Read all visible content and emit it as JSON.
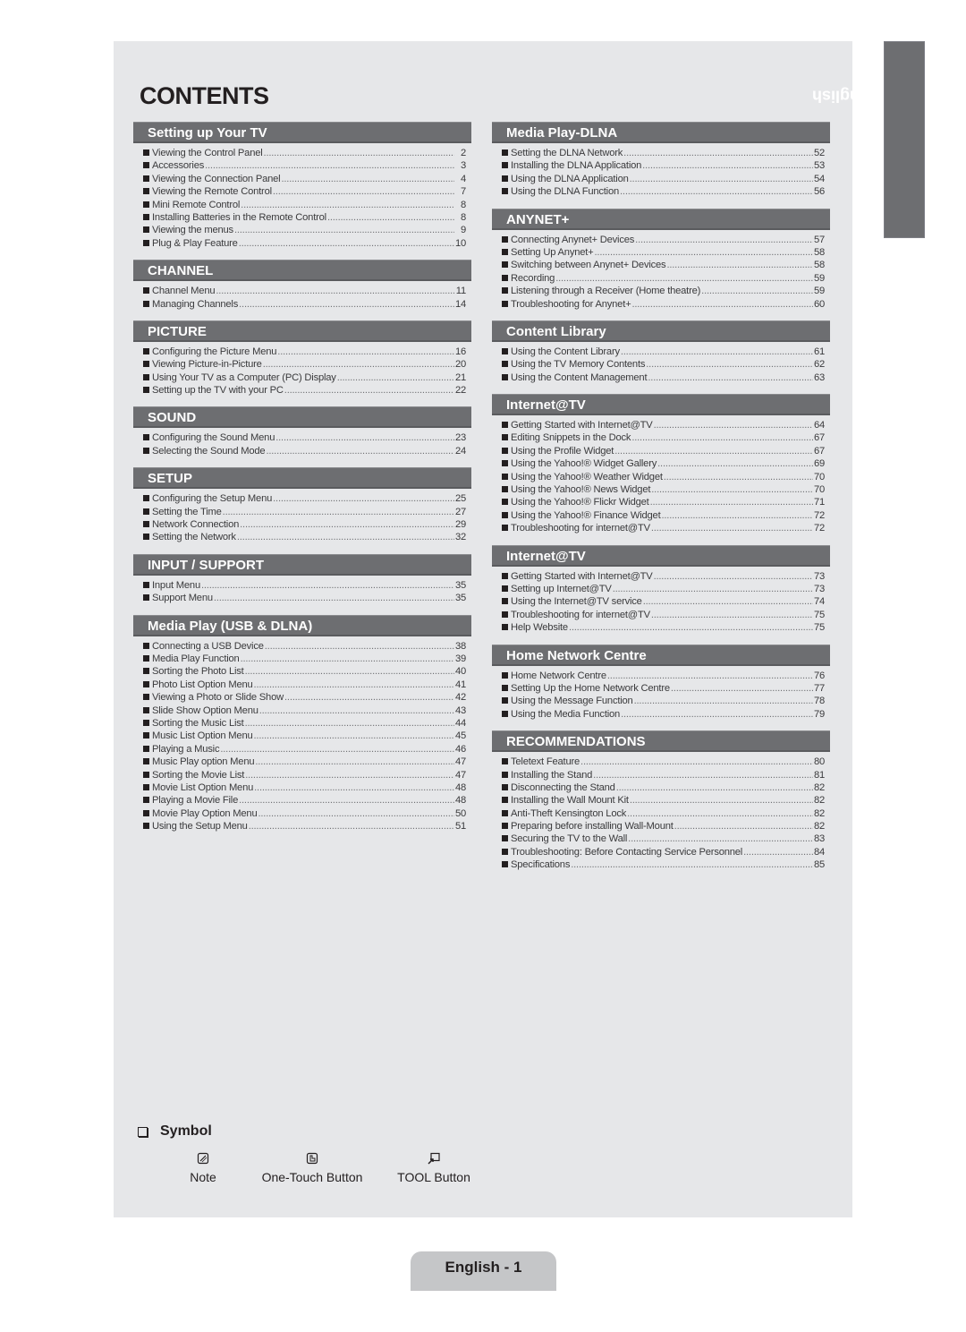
{
  "title": "CONTENTS",
  "language_tab": "English",
  "footer": "English - 1",
  "left_sections": [
    {
      "heading": "Setting up Your TV",
      "items": [
        {
          "label": "Viewing the Control Panel",
          "page": "2"
        },
        {
          "label": "Accessories",
          "page": "3"
        },
        {
          "label": "Viewing the Connection Panel",
          "page": "4"
        },
        {
          "label": "Viewing the Remote Control",
          "page": "7"
        },
        {
          "label": "Mini Remote Control",
          "page": "8"
        },
        {
          "label": "Installing Batteries in the Remote Control",
          "page": "8"
        },
        {
          "label": "Viewing the menus",
          "page": "9"
        },
        {
          "label": "Plug & Play Feature",
          "page": "10"
        }
      ]
    },
    {
      "heading": "CHANNEL",
      "items": [
        {
          "label": "Channel Menu",
          "page": "11"
        },
        {
          "label": "Managing Channels",
          "page": "14"
        }
      ]
    },
    {
      "heading": "PICTURE",
      "items": [
        {
          "label": "Configuring the Picture Menu",
          "page": "16"
        },
        {
          "label": "Viewing Picture-in-Picture",
          "page": "20"
        },
        {
          "label": "Using Your TV as a Computer (PC) Display",
          "page": "21"
        },
        {
          "label": "Setting up the TV with your PC",
          "page": "22"
        }
      ]
    },
    {
      "heading": "SOUND",
      "items": [
        {
          "label": "Configuring the Sound Menu",
          "page": "23"
        },
        {
          "label": "Selecting the Sound Mode",
          "page": "24"
        }
      ]
    },
    {
      "heading": "SETUP",
      "items": [
        {
          "label": "Configuring the Setup Menu",
          "page": "25"
        },
        {
          "label": "Setting the Time",
          "page": "27"
        },
        {
          "label": "Network Connection",
          "page": "29"
        },
        {
          "label": "Setting the Network",
          "page": "32"
        }
      ]
    },
    {
      "heading": "INPUT / SUPPORT",
      "items": [
        {
          "label": "Input Menu",
          "page": "35"
        },
        {
          "label": "Support Menu",
          "page": "35"
        }
      ]
    },
    {
      "heading": "Media Play (USB & DLNA)",
      "items": [
        {
          "label": "Connecting a USB Device",
          "page": "38"
        },
        {
          "label": "Media Play Function",
          "page": "39"
        },
        {
          "label": "Sorting the Photo List",
          "page": "40"
        },
        {
          "label": "Photo List Option Menu",
          "page": "41"
        },
        {
          "label": "Viewing a Photo or Slide Show",
          "page": "42"
        },
        {
          "label": "Slide Show Option Menu",
          "page": "43"
        },
        {
          "label": "Sorting the Music List",
          "page": "44"
        },
        {
          "label": "Music List Option Menu",
          "page": "45"
        },
        {
          "label": "Playing a Music",
          "page": "46"
        },
        {
          "label": "Music Play option Menu",
          "page": "47"
        },
        {
          "label": "Sorting the Movie List",
          "page": "47"
        },
        {
          "label": "Movie List Option Menu",
          "page": "48"
        },
        {
          "label": "Playing a Movie File",
          "page": "48"
        },
        {
          "label": "Movie Play Option Menu",
          "page": "50"
        },
        {
          "label": "Using the Setup Menu",
          "page": "51"
        }
      ]
    }
  ],
  "right_sections": [
    {
      "heading": "Media Play-DLNA",
      "items": [
        {
          "label": "Setting the DLNA Network",
          "page": "52"
        },
        {
          "label": "Installing the DLNA Application",
          "page": "53"
        },
        {
          "label": "Using the DLNA Application",
          "page": "54"
        },
        {
          "label": "Using the DLNA Function",
          "page": "56"
        }
      ]
    },
    {
      "heading": "ANYNET+",
      "items": [
        {
          "label": "Connecting Anynet+ Devices",
          "page": "57"
        },
        {
          "label": "Setting Up Anynet+",
          "page": "58"
        },
        {
          "label": "Switching between Anynet+ Devices",
          "page": "58"
        },
        {
          "label": "Recording",
          "page": "59"
        },
        {
          "label": "Listening through a Receiver (Home theatre)",
          "page": "59"
        },
        {
          "label": "Troubleshooting for Anynet+",
          "page": "60"
        }
      ]
    },
    {
      "heading": "Content Library",
      "items": [
        {
          "label": "Using the Content Library",
          "page": "61"
        },
        {
          "label": "Using the TV Memory Contents",
          "page": "62"
        },
        {
          "label": "Using the Content Management",
          "page": "63"
        }
      ]
    },
    {
      "heading": "Internet@TV",
      "items": [
        {
          "label": "Getting Started with Internet@TV",
          "page": "64"
        },
        {
          "label": "Editing Snippets in the Dock",
          "page": "67"
        },
        {
          "label": "Using the Profile Widget",
          "page": "67"
        },
        {
          "label": "Using the Yahoo!® Widget Gallery",
          "page": "69"
        },
        {
          "label": "Using the Yahoo!® Weather Widget",
          "page": "70"
        },
        {
          "label": "Using the Yahoo!® News Widget",
          "page": "70"
        },
        {
          "label": "Using the Yahoo!® Flickr Widget",
          "page": "71"
        },
        {
          "label": "Using the Yahoo!® Finance Widget",
          "page": "72"
        },
        {
          "label": "Troubleshooting for internet@TV",
          "page": "72"
        }
      ]
    },
    {
      "heading": "Internet@TV",
      "items": [
        {
          "label": "Getting Started with Internet@TV",
          "page": "73"
        },
        {
          "label": "Setting up Internet@TV",
          "page": "73"
        },
        {
          "label": "Using the Internet@TV service",
          "page": "74"
        },
        {
          "label": "Troubleshooting for internet@TV",
          "page": "75"
        },
        {
          "label": "Help Website",
          "page": "75"
        }
      ]
    },
    {
      "heading": "Home Network Centre",
      "items": [
        {
          "label": "Home Network Centre",
          "page": "76"
        },
        {
          "label": "Setting Up the Home Network Centre",
          "page": "77"
        },
        {
          "label": "Using the Message Function",
          "page": "78"
        },
        {
          "label": "Using the Media Function",
          "page": "79"
        }
      ]
    },
    {
      "heading": "RECOMMENDATIONS",
      "items": [
        {
          "label": "Teletext Feature",
          "page": "80"
        },
        {
          "label": "Installing the Stand",
          "page": "81"
        },
        {
          "label": "Disconnecting the Stand",
          "page": "82"
        },
        {
          "label": "Installing the Wall Mount Kit",
          "page": "82"
        },
        {
          "label": "Anti-Theft Kensington Lock",
          "page": "82"
        },
        {
          "label": "Preparing before installing Wall-Mount",
          "page": "82"
        },
        {
          "label": "Securing the TV to the Wall",
          "page": "83"
        },
        {
          "label": "Troubleshooting: Before Contacting Service Personnel",
          "page": "84"
        },
        {
          "label": "Specifications",
          "page": "85"
        }
      ]
    }
  ],
  "symbol": {
    "heading": "Symbol",
    "items": [
      {
        "icon": "note-icon",
        "label": "Note"
      },
      {
        "icon": "one-touch-icon",
        "label": "One-Touch Button"
      },
      {
        "icon": "tool-icon",
        "label": "TOOL Button"
      }
    ]
  }
}
